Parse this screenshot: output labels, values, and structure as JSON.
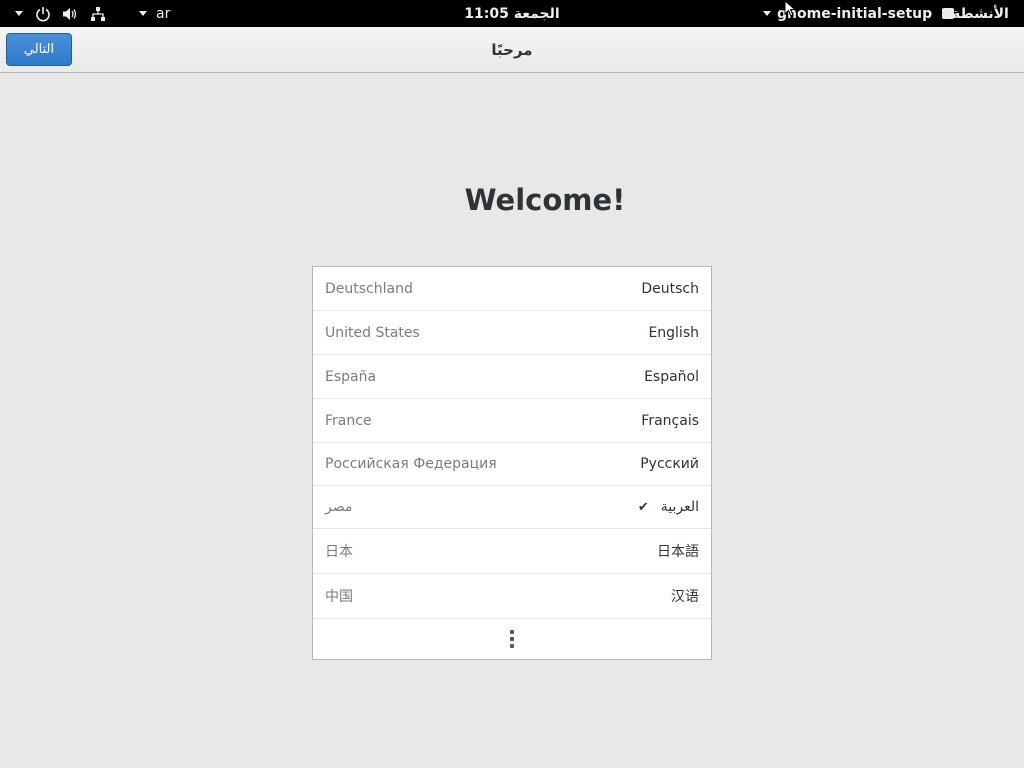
{
  "top_bar": {
    "keyboard_layout": "ar",
    "clock": "الجمعة 11:05",
    "app_menu_label": "gnome-initial-setup",
    "activities_label": "الأنشطة"
  },
  "header": {
    "title": "مرحبًا",
    "next_button_label": "التالي",
    "accent_color": "#3584e4"
  },
  "main": {
    "welcome_text": "Welcome!",
    "languages": [
      {
        "country": "Deutschland",
        "language": "Deutsch",
        "selected": false
      },
      {
        "country": "United States",
        "language": "English",
        "selected": false
      },
      {
        "country": "España",
        "language": "Español",
        "selected": false
      },
      {
        "country": "France",
        "language": "Français",
        "selected": false
      },
      {
        "country": "Российская Федерация",
        "language": "Русский",
        "selected": false
      },
      {
        "country": "مصر",
        "language": "العربية",
        "selected": true
      },
      {
        "country": "日本",
        "language": "日本語",
        "selected": false
      },
      {
        "country": "中国",
        "language": "汉语",
        "selected": false
      }
    ],
    "more_icon": "vertical-ellipsis-icon"
  }
}
